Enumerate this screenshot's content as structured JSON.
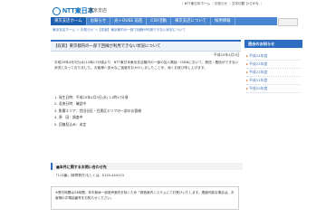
{
  "header": {
    "logo_text": "NTT東日本",
    "branch": "東京支店",
    "top_links": "｜NTT東日本ホーム ｜お知らせ ｜文字切替 ひらがな ｜"
  },
  "nav": [
    "東京支店ホーム",
    "お知らせ",
    "光＋OUSE 前進",
    "CSR活動",
    "東京支店について",
    "採用情報"
  ],
  "breadcrumb": "東京支店ホーム ＞ お知らせ ＞【収束】東京都内の一部で回線が利用できない状況について",
  "article": {
    "title": "【収束】東京都内の一部で回線が利用できない状況について",
    "date": "平成25年4月3日",
    "body": "平成25年4月3日(水)11時17分頃より、NTT東日本東京支店管内の一部の加入電話・ISDNにおいて、発信・着信ができない状況となっておりました。お客様へ多大なご迷惑をおかけしましたことを、深くお詫び申し上げます。",
    "items": [
      "1. 発生日時：平成25年4月3日(水) 11時17分頃",
      "2. 収束日時：確認中",
      "3. 影響エリア：世田谷区・目黒区エリアの一部のお客様",
      "4. 原　因：調査中",
      "5. 回復見込み：未定"
    ]
  },
  "contact": {
    "heading": "■本件に関するお問い合わせ先",
    "text": "「113番」(故障受付)もしくは、0120-444113",
    "note": "※受付時間は24時間、年中無休一部音声案内を除くため「録音案内システムにてお受けいたします。連絡可能な場合は、お客様のお電話番号をお知らせください。"
  },
  "sidebar": {
    "heading": "過去のお知らせ",
    "items": [
      "平成24年度",
      "平成23年度",
      "平成22年度",
      "平成21年度",
      "平成20年度"
    ]
  }
}
